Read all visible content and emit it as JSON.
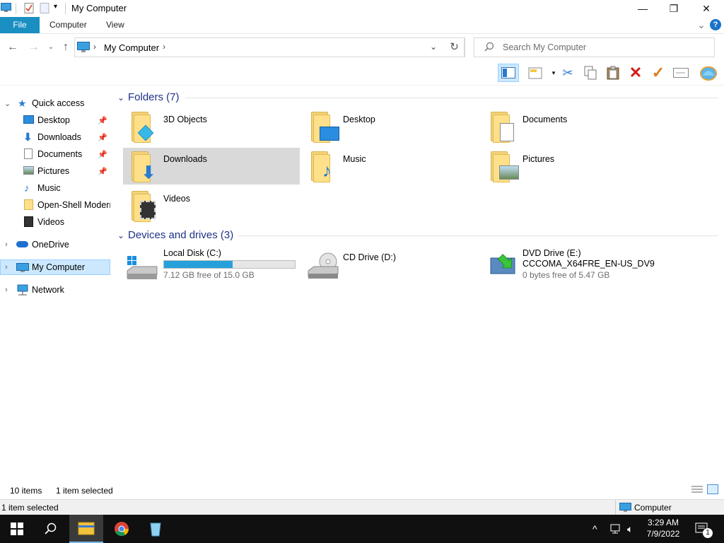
{
  "window": {
    "title": "My Computer",
    "minimize": "—",
    "restore": "❐",
    "close": "✕"
  },
  "ribbon": {
    "tabs": [
      "File",
      "Computer",
      "View"
    ],
    "expand": "⌄",
    "help": "?"
  },
  "address": {
    "crumb": "My Computer",
    "sep": "›",
    "search_placeholder": "Search My Computer"
  },
  "sidebar": {
    "quick_access": "Quick access",
    "quick_items": [
      {
        "label": "Desktop",
        "pinned": true
      },
      {
        "label": "Downloads",
        "pinned": true
      },
      {
        "label": "Documents",
        "pinned": true
      },
      {
        "label": "Pictures",
        "pinned": true
      },
      {
        "label": "Music",
        "pinned": false
      },
      {
        "label": "Open-Shell Modern",
        "pinned": false
      },
      {
        "label": "Videos",
        "pinned": false
      }
    ],
    "onedrive": "OneDrive",
    "my_computer": "My Computer",
    "network": "Network"
  },
  "content": {
    "folders_header": "Folders (7)",
    "folders": [
      "3D Objects",
      "Desktop",
      "Documents",
      "Downloads",
      "Music",
      "Pictures",
      "Videos"
    ],
    "drives_header": "Devices and drives (3)",
    "drives": [
      {
        "name": "Local Disk (C:)",
        "free": "7.12 GB free of 15.0 GB",
        "used_fraction": 0.525
      },
      {
        "name": "CD Drive (D:)"
      },
      {
        "name": "DVD Drive (E:)",
        "label": "CCCOMA_X64FRE_EN-US_DV9",
        "free": "0 bytes free of 5.47 GB"
      }
    ]
  },
  "status": {
    "count": "10 items",
    "selected": "1 item selected",
    "bottom_left": "1 item selected",
    "bottom_right": "Computer"
  },
  "taskbar": {
    "time": "3:29 AM",
    "date": "7/9/2022",
    "notif_count": "1"
  },
  "colors": {
    "accent": "#1a8fc2",
    "section_text": "#1e3287",
    "selection": "#cce8ff",
    "drive_bar": "#26a0da"
  }
}
